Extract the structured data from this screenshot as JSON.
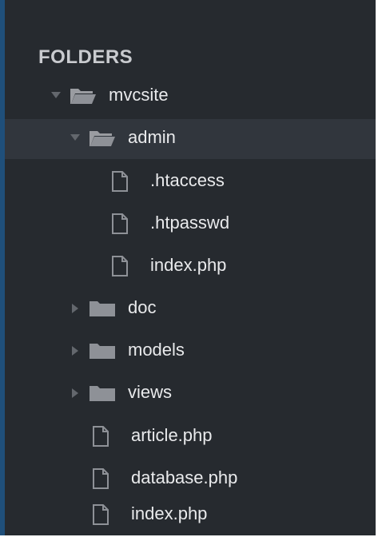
{
  "sidebar": {
    "title": "FOLDERS",
    "items": [
      {
        "label": "mvcsite"
      },
      {
        "label": "admin"
      },
      {
        "label": ".htaccess"
      },
      {
        "label": ".htpasswd"
      },
      {
        "label": "index.php"
      },
      {
        "label": "doc"
      },
      {
        "label": "models"
      },
      {
        "label": "views"
      },
      {
        "label": "article.php"
      },
      {
        "label": "database.php"
      },
      {
        "label": "index.php"
      }
    ]
  },
  "colors": {
    "panel_bg": "#262a2f",
    "accent_border": "#1f4f7a",
    "text": "#e9eaec",
    "icon": "#8e9197"
  }
}
